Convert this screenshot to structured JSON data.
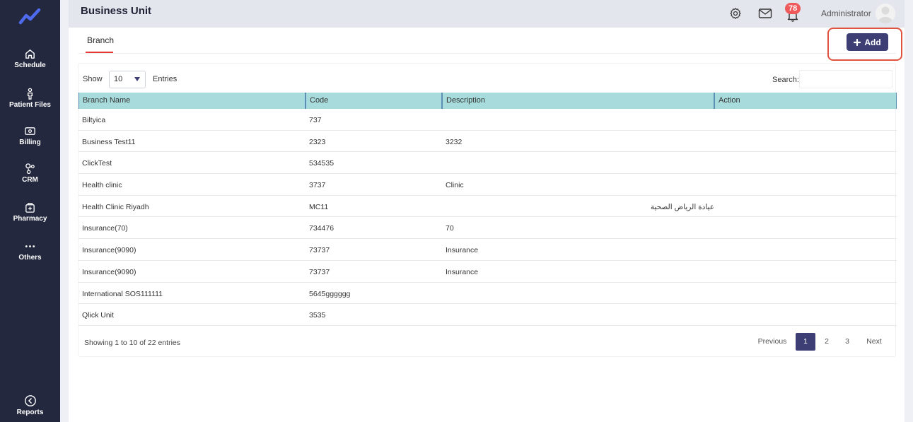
{
  "sidebar": {
    "items": [
      {
        "label": "Schedule",
        "icon": "home-icon"
      },
      {
        "label": "Patient Files",
        "icon": "patient-icon"
      },
      {
        "label": "Billing",
        "icon": "billing-icon"
      },
      {
        "label": "CRM",
        "icon": "crm-icon"
      },
      {
        "label": "Pharmacy",
        "icon": "pharmacy-icon"
      },
      {
        "label": "Others",
        "icon": "more-icon"
      }
    ],
    "reports": {
      "label": "Reports",
      "icon": "chevron-left-icon"
    }
  },
  "header": {
    "title": "Business Unit",
    "notification_count": "78",
    "user_name": "Administrator"
  },
  "tabs": [
    {
      "label": "Branch",
      "active": true
    }
  ],
  "toolbar": {
    "add_label": "Add"
  },
  "table_controls": {
    "show_label": "Show",
    "page_size": "10",
    "entries_label": "Entries",
    "search_label": "Search:"
  },
  "table": {
    "columns": [
      "Branch Name",
      "Code",
      "Description",
      "Action"
    ],
    "rows": [
      [
        "Biltyica",
        "737",
        "",
        ""
      ],
      [
        "Business Test11",
        "2323",
        "3232",
        ""
      ],
      [
        "ClickTest",
        "534535",
        "",
        ""
      ],
      [
        "Health clinic",
        "3737",
        "Clinic",
        ""
      ],
      [
        "Health Clinic Riyadh",
        "MC11",
        "عيادة الرياض الصحية",
        ""
      ],
      [
        "Insurance(70)",
        "734476",
        "70",
        ""
      ],
      [
        "Insurance(9090)",
        "73737",
        "Insurance",
        ""
      ],
      [
        "Insurance(9090)",
        "73737",
        "Insurance",
        ""
      ],
      [
        "International SOS111111",
        "5645gggggg",
        "",
        ""
      ],
      [
        "Qlick Unit",
        "3535",
        "",
        ""
      ]
    ]
  },
  "pagination": {
    "summary": "Showing 1 to 10 of 22 entries",
    "previous": "Previous",
    "pages": [
      "1",
      "2",
      "3"
    ],
    "next": "Next"
  },
  "colors": {
    "sidebar": "#23283f",
    "accent": "#3d3f74",
    "header_row": "#a8dcdc",
    "tab_underline": "#e53935",
    "badge": "#ef5a5a"
  }
}
